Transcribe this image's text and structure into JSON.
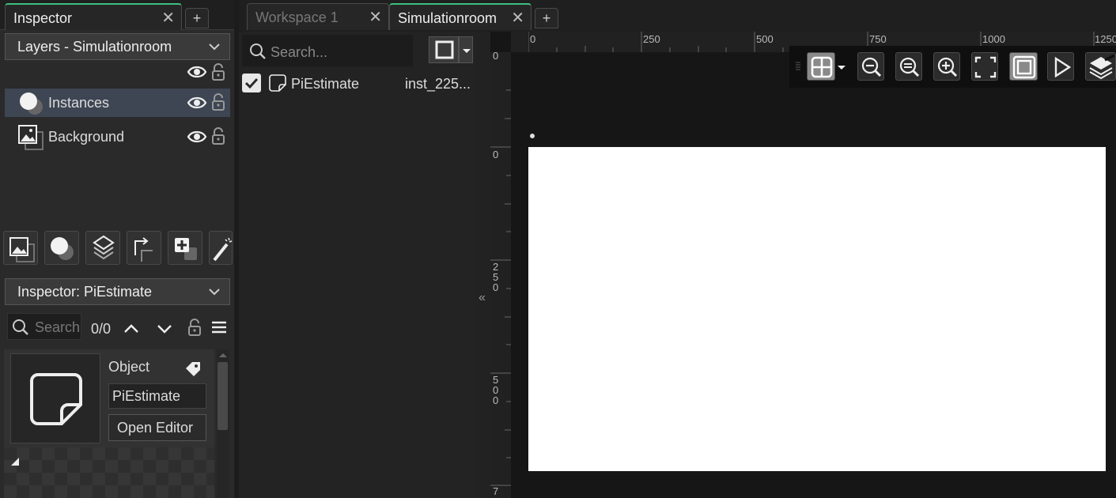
{
  "left_panel": {
    "tab_label": "Inspector",
    "layers_title": "Layers - Simulationroom",
    "layers": [
      {
        "label": "Instances"
      },
      {
        "label": "Background"
      }
    ],
    "inspector_title": "Inspector: PiEstimate",
    "search_placeholder": "Search",
    "match_count": "0/0",
    "object_heading": "Object",
    "object_name": "PiEstimate",
    "open_editor_label": "Open Editor"
  },
  "middle_panel": {
    "tabs": [
      {
        "label": "Workspace 1"
      },
      {
        "label": "Simulationroom"
      }
    ],
    "search_placeholder": "Search...",
    "instance": {
      "name": "PiEstimate",
      "id": "inst_225..."
    }
  },
  "room": {
    "ruler_h_ticks": [
      "0",
      "250",
      "500",
      "750",
      "1000",
      "1250"
    ],
    "ruler_v_ticks": [
      "0",
      "0",
      "250",
      "500",
      "7"
    ],
    "collapse_glyph": "«"
  },
  "colors": {
    "accent": "#3fbf7f",
    "selected_row": "#3e4553"
  }
}
